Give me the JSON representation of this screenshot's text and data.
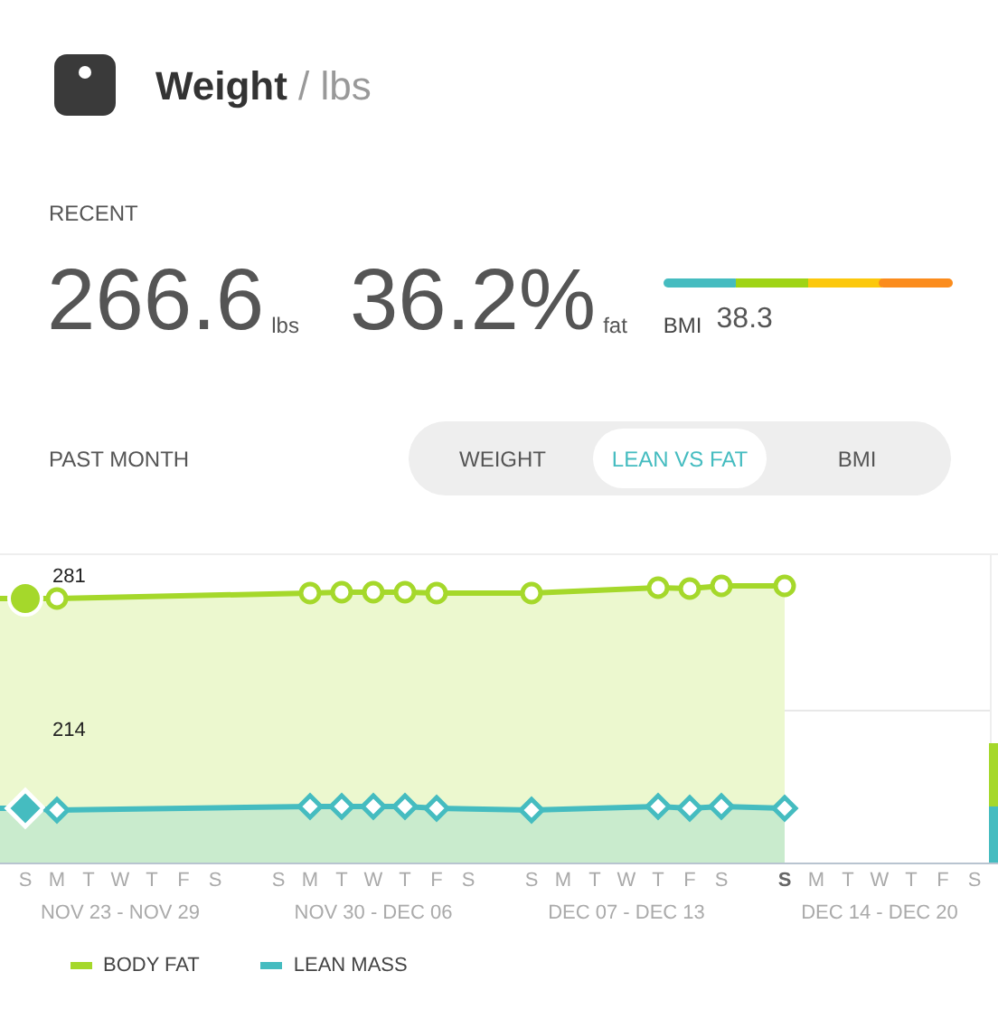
{
  "header": {
    "title": "Weight",
    "unit": "/ lbs"
  },
  "recent": {
    "label": "RECENT",
    "weight": {
      "value": "266.6",
      "unit": "lbs"
    },
    "fat": {
      "value": "36.2%",
      "unit": "fat"
    },
    "bmi": {
      "label": "BMI",
      "value": "38.3"
    }
  },
  "period": {
    "label": "PAST MONTH",
    "tabs": [
      {
        "label": "WEIGHT",
        "selected": false
      },
      {
        "label": "LEAN VS FAT",
        "selected": true
      },
      {
        "label": "BMI",
        "selected": false
      }
    ]
  },
  "chart": {
    "point_labels": [
      "281",
      "214"
    ],
    "weeks": [
      {
        "label": "NOV 23 - NOV 29",
        "days": [
          {
            "letter": "S",
            "current": false
          },
          {
            "letter": "M",
            "current": false
          },
          {
            "letter": "T",
            "current": false
          },
          {
            "letter": "W",
            "current": false
          },
          {
            "letter": "T",
            "current": false
          },
          {
            "letter": "F",
            "current": false
          },
          {
            "letter": "S",
            "current": false
          }
        ]
      },
      {
        "label": "NOV 30 - DEC 06",
        "days": [
          {
            "letter": "S",
            "current": false
          },
          {
            "letter": "M",
            "current": false
          },
          {
            "letter": "T",
            "current": false
          },
          {
            "letter": "W",
            "current": false
          },
          {
            "letter": "T",
            "current": false
          },
          {
            "letter": "F",
            "current": false
          },
          {
            "letter": "S",
            "current": false
          }
        ]
      },
      {
        "label": "DEC 07 - DEC 13",
        "days": [
          {
            "letter": "S",
            "current": false
          },
          {
            "letter": "M",
            "current": false
          },
          {
            "letter": "T",
            "current": false
          },
          {
            "letter": "W",
            "current": false
          },
          {
            "letter": "T",
            "current": false
          },
          {
            "letter": "F",
            "current": false
          },
          {
            "letter": "S",
            "current": false
          }
        ]
      },
      {
        "label": "DEC 14 - DEC 20",
        "days": [
          {
            "letter": "S",
            "current": true
          },
          {
            "letter": "M",
            "current": false
          },
          {
            "letter": "T",
            "current": false
          },
          {
            "letter": "W",
            "current": false
          },
          {
            "letter": "T",
            "current": false
          },
          {
            "letter": "F",
            "current": false
          },
          {
            "letter": "S",
            "current": false
          }
        ]
      }
    ],
    "legend": [
      {
        "label": "BODY FAT",
        "color": "#a5d82b"
      },
      {
        "label": "LEAN MASS",
        "color": "#45bcc0"
      }
    ]
  }
}
